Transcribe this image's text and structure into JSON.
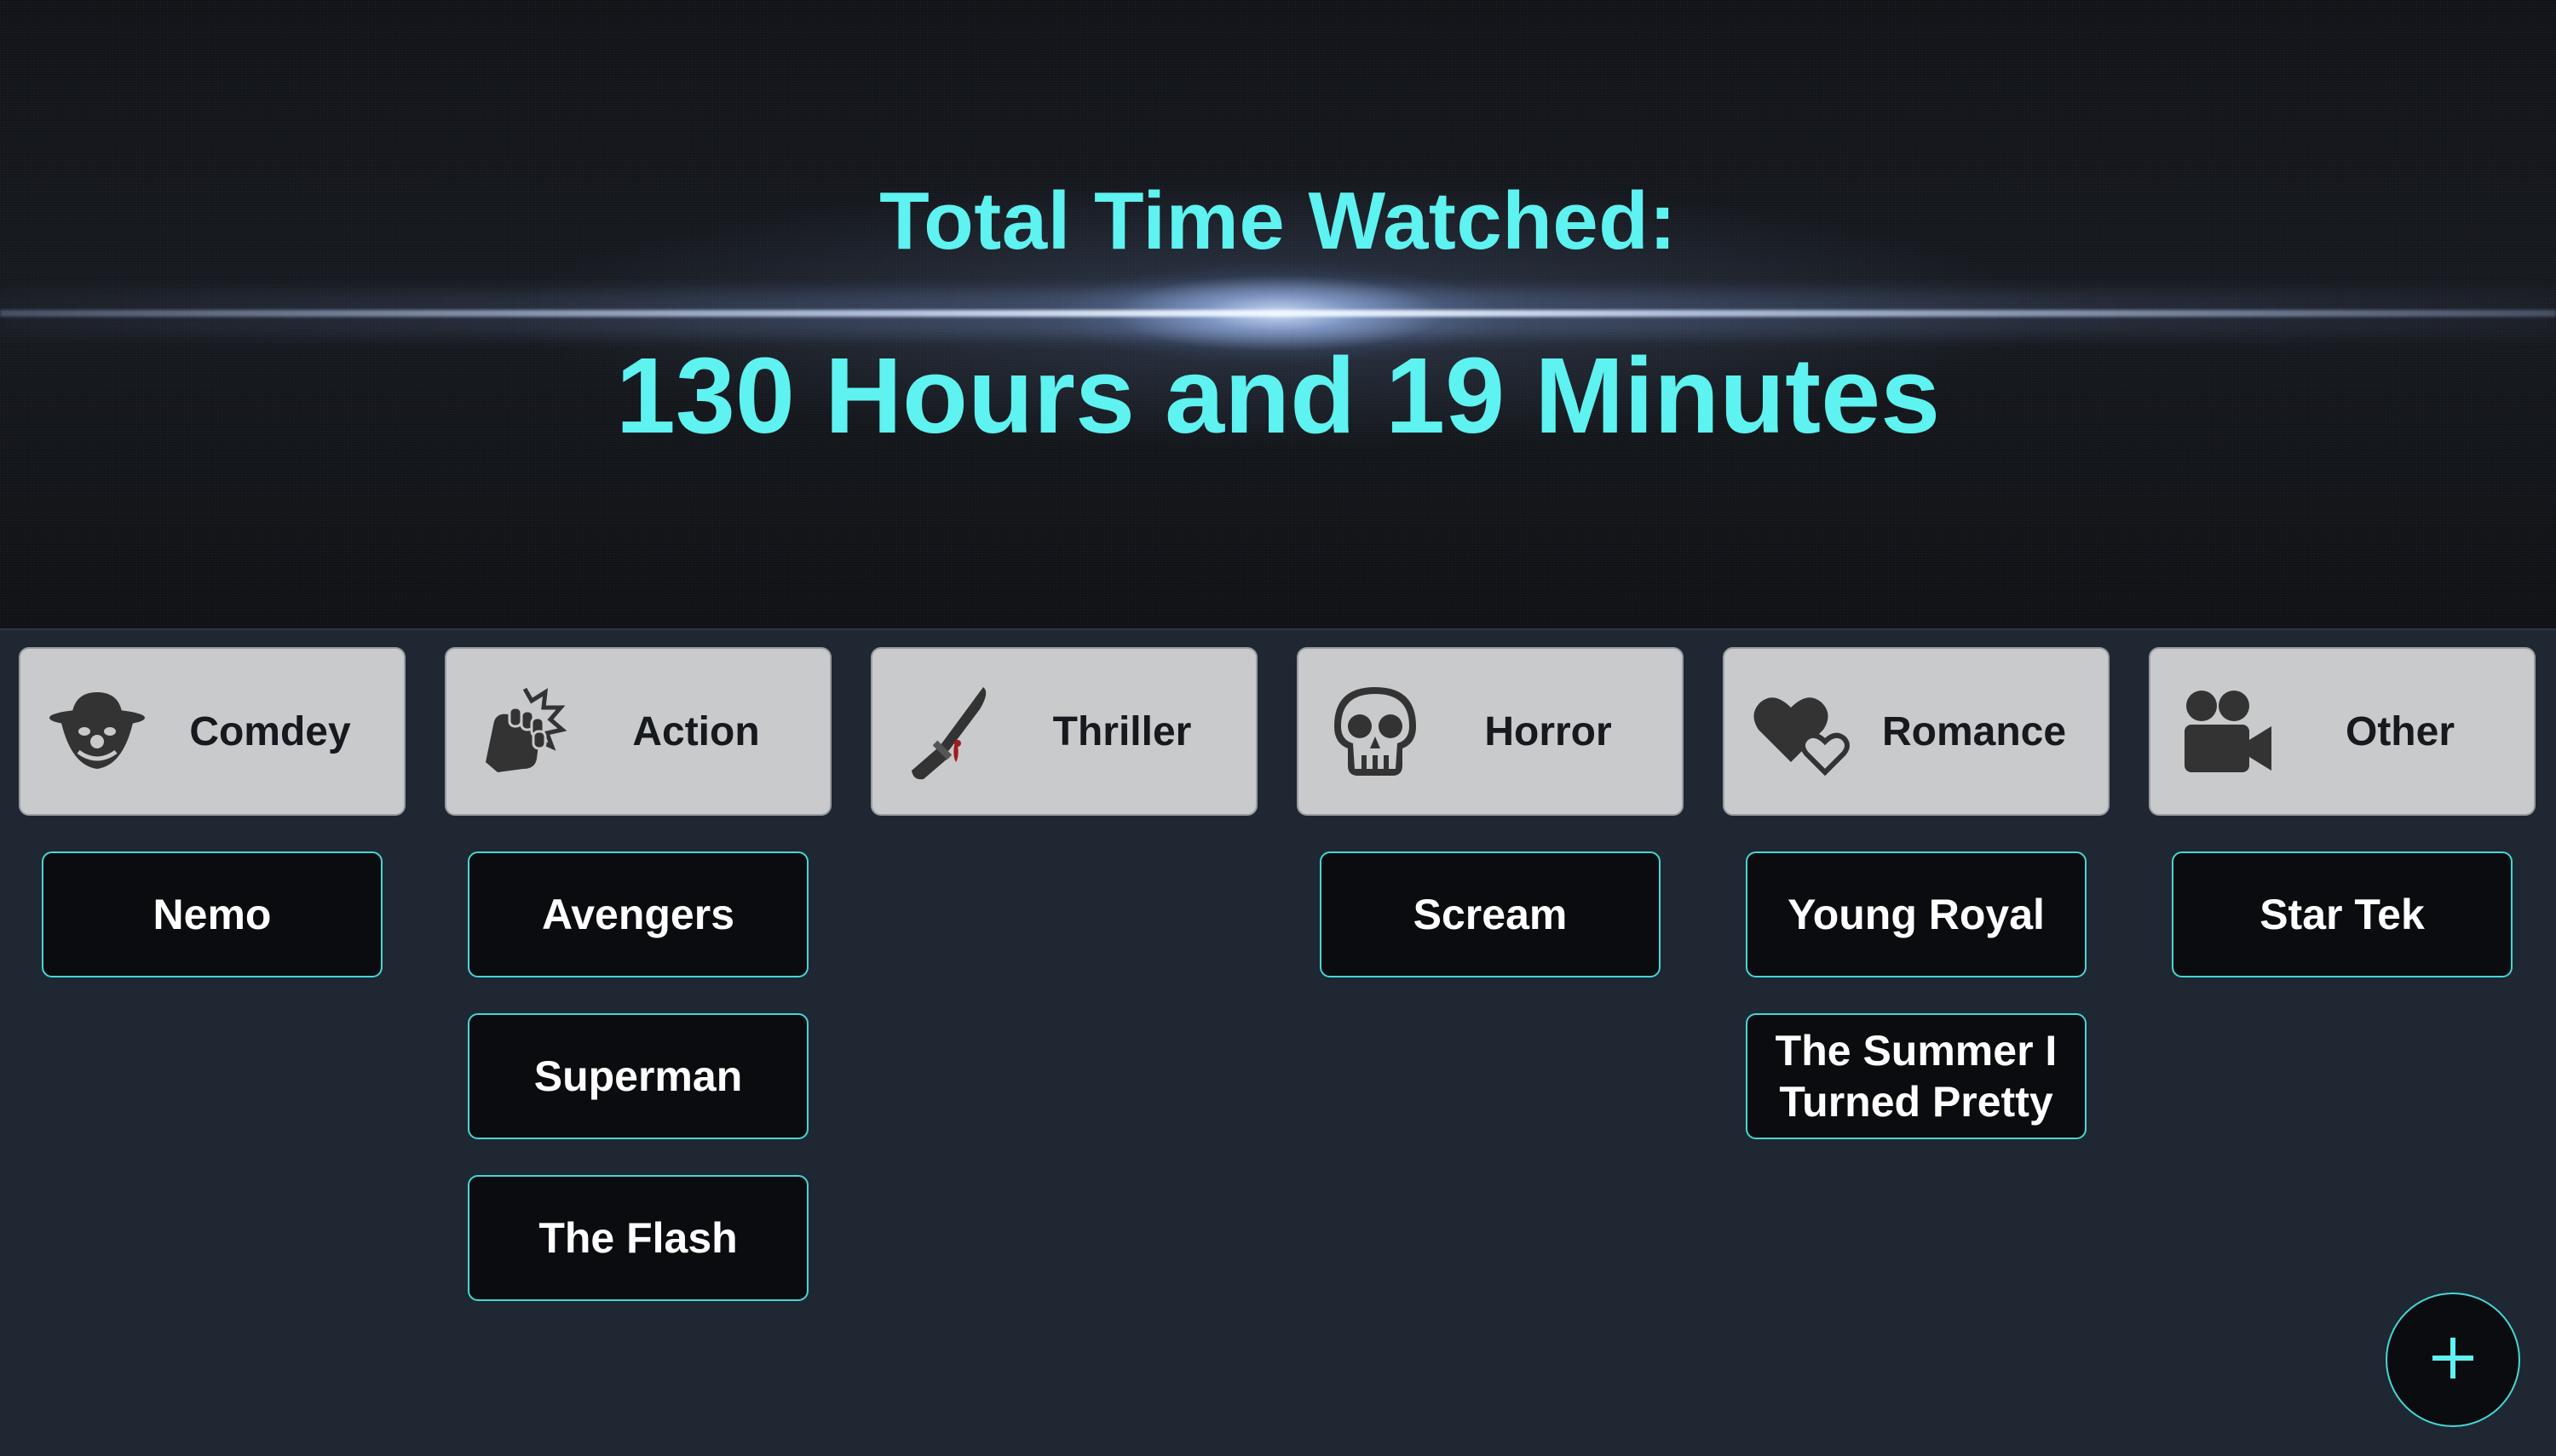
{
  "hero": {
    "subtitle": "Total Time Watched:",
    "total": "130 Hours and 19 Minutes"
  },
  "colors": {
    "accent": "#5ef2f0",
    "card_border": "#45d6d6",
    "background": "#1f2733",
    "header_bg": "#c9cacc"
  },
  "genres": [
    {
      "label": "Comdey",
      "icon": "clown-face-icon",
      "movies": [
        "Nemo"
      ]
    },
    {
      "label": "Action",
      "icon": "fist-punch-icon",
      "movies": [
        "Avengers",
        "Superman",
        "The Flash"
      ]
    },
    {
      "label": "Thriller",
      "icon": "bloody-knife-icon",
      "movies": []
    },
    {
      "label": "Horror",
      "icon": "skull-icon",
      "movies": [
        "Scream"
      ]
    },
    {
      "label": "Romance",
      "icon": "hearts-icon",
      "movies": [
        "Young Royal",
        "The Summer I Turned Pretty"
      ]
    },
    {
      "label": "Other",
      "icon": "video-camera-icon",
      "movies": [
        "Star Tek"
      ]
    }
  ],
  "fab": {
    "icon": "plus-icon"
  }
}
